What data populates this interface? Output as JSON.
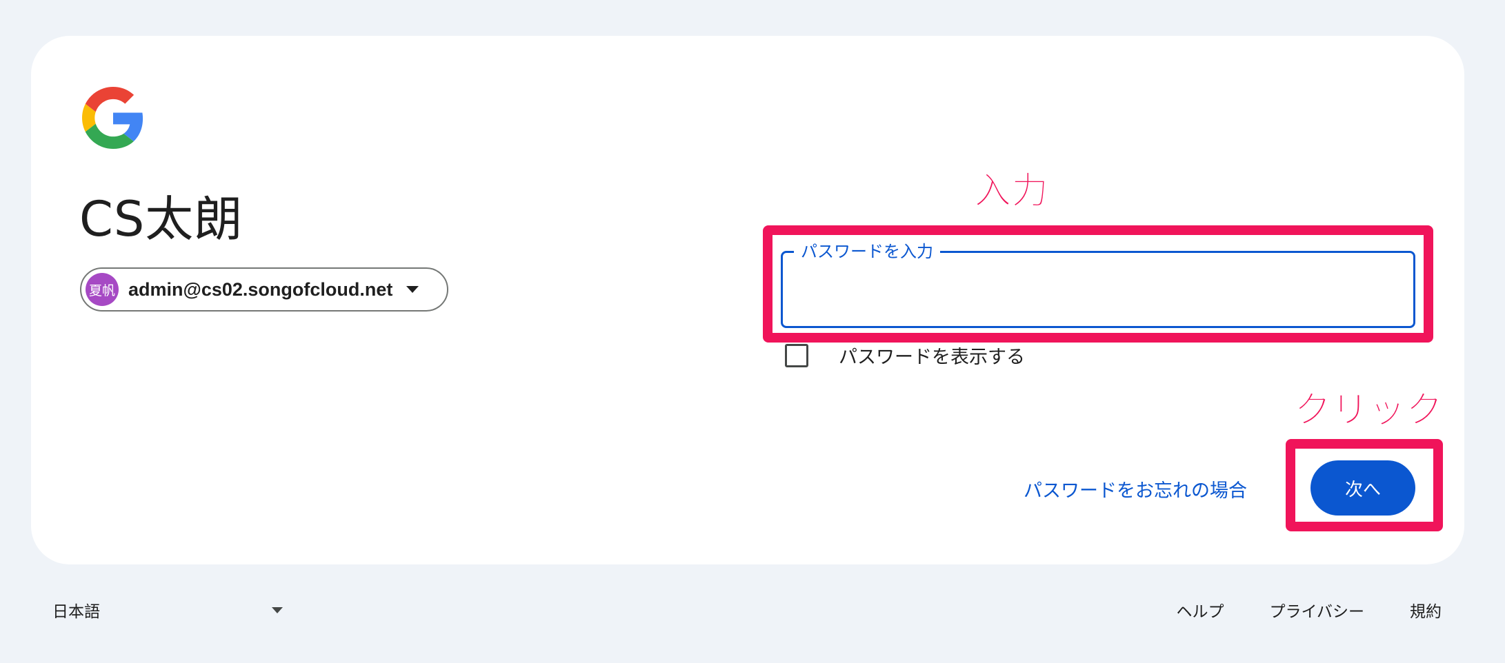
{
  "logo": {
    "icon": "google-g-icon"
  },
  "user": {
    "name": "CS太朗",
    "avatar_text": "夏帆",
    "avatar_color": "#a649c4",
    "email": "admin@cs02.songofcloud.net"
  },
  "password": {
    "label": "パスワードを入力",
    "value": "",
    "show_label": "パスワードを表示する"
  },
  "actions": {
    "forgot_label": "パスワードをお忘れの場合",
    "next_label": "次へ"
  },
  "annotations": {
    "input_label": "入力",
    "click_label": "クリック",
    "color": "#f0145a"
  },
  "footer": {
    "language": "日本語",
    "links": [
      "ヘルプ",
      "プライバシー",
      "規約"
    ]
  },
  "colors": {
    "accent": "#0b57d0",
    "background": "#eff3f8"
  }
}
